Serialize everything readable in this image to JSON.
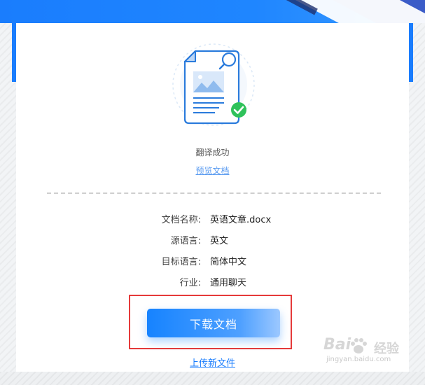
{
  "status": {
    "success_text": "翻译成功",
    "preview_link": "预览文档"
  },
  "info": {
    "doc_name_label": "文档名称:",
    "doc_name_value": "英语文章.docx",
    "source_lang_label": "源语言:",
    "source_lang_value": "英文",
    "target_lang_label": "目标语言:",
    "target_lang_value": "简体中文",
    "industry_label": "行业:",
    "industry_value": "通用聊天"
  },
  "actions": {
    "download_label": "下载文档",
    "upload_label": "上传新文件"
  },
  "watermark": {
    "logo_text": "Bai",
    "brand_text": "经验",
    "url_text": "jingyan.baidu.com"
  },
  "colors": {
    "accent": "#1a7dfd",
    "success": "#2fc25b",
    "highlight": "#e53a3a"
  }
}
